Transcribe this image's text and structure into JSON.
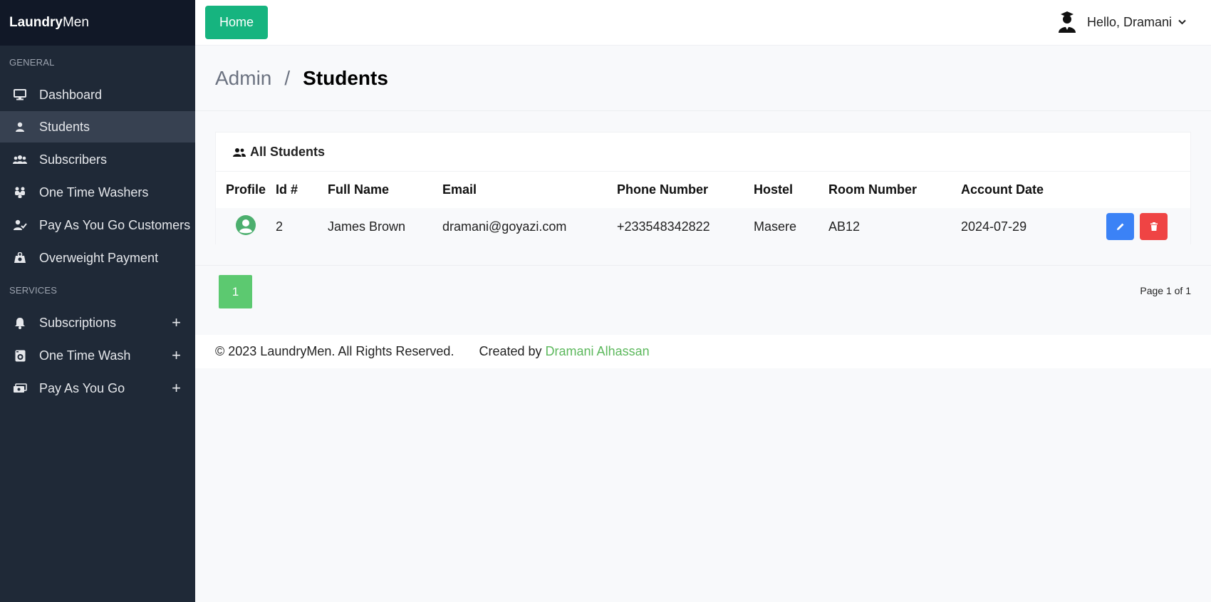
{
  "brand": {
    "bold": "Laundry",
    "regular": "Men"
  },
  "sidebar": {
    "general_label": "GENERAL",
    "services_label": "SERVICES",
    "general_items": [
      {
        "label": "Dashboard",
        "icon": "monitor-icon"
      },
      {
        "label": "Students",
        "icon": "user-icon",
        "active": true
      },
      {
        "label": "Subscribers",
        "icon": "users-icon"
      },
      {
        "label": "One Time Washers",
        "icon": "people-group-icon"
      },
      {
        "label": "Pay As You Go Customers",
        "icon": "user-check-icon"
      },
      {
        "label": "Overweight Payment",
        "icon": "weight-scale-icon"
      }
    ],
    "service_items": [
      {
        "label": "Subscriptions",
        "icon": "bell-icon"
      },
      {
        "label": "One Time Wash",
        "icon": "washing-machine-icon"
      },
      {
        "label": "Pay As You Go",
        "icon": "money-bill-icon"
      }
    ],
    "expand_symbol": "+"
  },
  "topbar": {
    "home_label": "Home",
    "greeting": "Hello, Dramani",
    "chevron": "⌄"
  },
  "breadcrumb": {
    "parent": "Admin",
    "separator": "/",
    "current": "Students"
  },
  "card": {
    "title": "All Students",
    "columns": [
      "Profile",
      "Id #",
      "Full Name",
      "Email",
      "Phone Number",
      "Hostel",
      "Room Number",
      "Account Date"
    ],
    "rows": [
      {
        "id": "2",
        "full_name": "James Brown",
        "email": "dramani@goyazi.com",
        "phone": "+233548342822",
        "hostel": "Masere",
        "room": "AB12",
        "date": "2024-07-29"
      }
    ]
  },
  "pagination": {
    "current_page": "1",
    "info": "Page 1 of 1"
  },
  "footer": {
    "copyright": "© 2023 LaundryMen. All Rights Reserved.",
    "created_prefix": "Created by",
    "author": "Dramani Alhassan"
  },
  "colors": {
    "sidebar_bg": "#1f2937",
    "brand_bg": "#111827",
    "home_button": "#16b47f",
    "edit_button": "#3b82f6",
    "delete_button": "#ef4444",
    "page_button": "#5cc970",
    "link": "#5cb85c"
  }
}
